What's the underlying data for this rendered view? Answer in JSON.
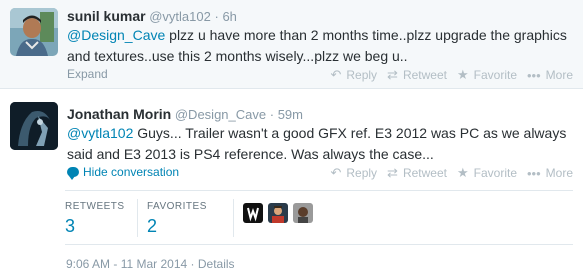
{
  "tweet1": {
    "name": "sunil kumar",
    "handle": "@vytla102",
    "time": "6h",
    "mention": "@Design_Cave",
    "text_line1_rest": " plzz u have more than 2 months time..plzz upgrade the graphics",
    "text_line2": "and textures..use this 2 months wisely...plzz we beg u..",
    "expand_label": "Expand",
    "actions": {
      "reply": "Reply",
      "retweet": "Retweet",
      "favorite": "Favorite",
      "more": "More"
    }
  },
  "tweet2": {
    "name": "Jonathan Morin",
    "handle": "@Design_Cave",
    "time": "59m",
    "mention": "@vytla102",
    "text_line1_rest": " Guys... Trailer wasn't a good GFX ref. E3 2012 was PC as we always",
    "text_line2": "said and E3 2013 is PS4 reference. Was always the case...",
    "hide_conversation_label": "Hide conversation",
    "actions": {
      "reply": "Reply",
      "retweet": "Retweet",
      "favorite": "Favorite",
      "more": "More"
    },
    "stats": {
      "retweets_label": "RETWEETS",
      "retweets_count": "3",
      "favorites_label": "FAVORITES",
      "favorites_count": "2"
    },
    "footer": {
      "timestamp": "9:06 AM - 11 Mar 2014",
      "separator": "·",
      "details": "Details"
    }
  },
  "colors": {
    "link": "#0084b4",
    "muted": "#8899a6",
    "text": "#292f33",
    "highlight_bg": "#f5f8fa"
  }
}
